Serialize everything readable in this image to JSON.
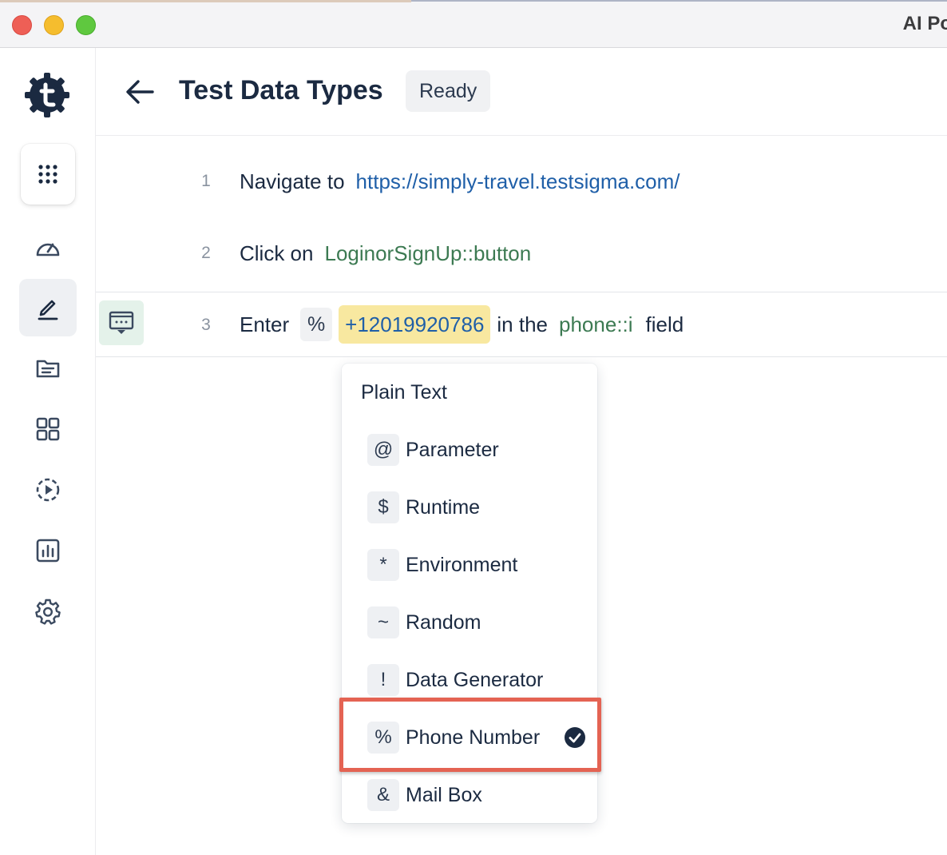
{
  "window": {
    "title": "AI Po"
  },
  "header": {
    "title": "Test Data Types",
    "status": "Ready"
  },
  "sidebar": {
    "items": [
      {
        "icon": "apps-grid-icon"
      },
      {
        "icon": "dashboard-gauge-icon"
      },
      {
        "icon": "edit-icon",
        "active": true
      },
      {
        "icon": "folder-icon"
      },
      {
        "icon": "modules-grid-icon"
      },
      {
        "icon": "run-play-icon"
      },
      {
        "icon": "reports-chart-icon"
      },
      {
        "icon": "settings-gear-icon"
      }
    ]
  },
  "steps": [
    {
      "number": "1",
      "action": "Navigate to",
      "target": "https://simply-travel.testsigma.com/"
    },
    {
      "number": "2",
      "action": "Click on",
      "target": "LoginorSignUp::button"
    },
    {
      "number": "3",
      "action": "Enter",
      "data_type_symbol": "%",
      "value": "+12019920786",
      "mid": "in the",
      "element": "phone::i",
      "suffix": "field"
    }
  ],
  "dropdown": {
    "heading": "Plain Text",
    "items": [
      {
        "symbol": "@",
        "label": "Parameter"
      },
      {
        "symbol": "$",
        "label": "Runtime"
      },
      {
        "symbol": "*",
        "label": "Environment"
      },
      {
        "symbol": "~",
        "label": "Random"
      },
      {
        "symbol": "!",
        "label": "Data Generator"
      },
      {
        "symbol": "%",
        "label": "Phone Number",
        "selected": true
      },
      {
        "symbol": "&",
        "label": "Mail Box"
      }
    ]
  },
  "colors": {
    "accent": "#1b2a41",
    "link": "#1f5fa8",
    "element": "#3c7a52",
    "value_highlight": "#f8e8a0",
    "annotation": "#e46353"
  }
}
